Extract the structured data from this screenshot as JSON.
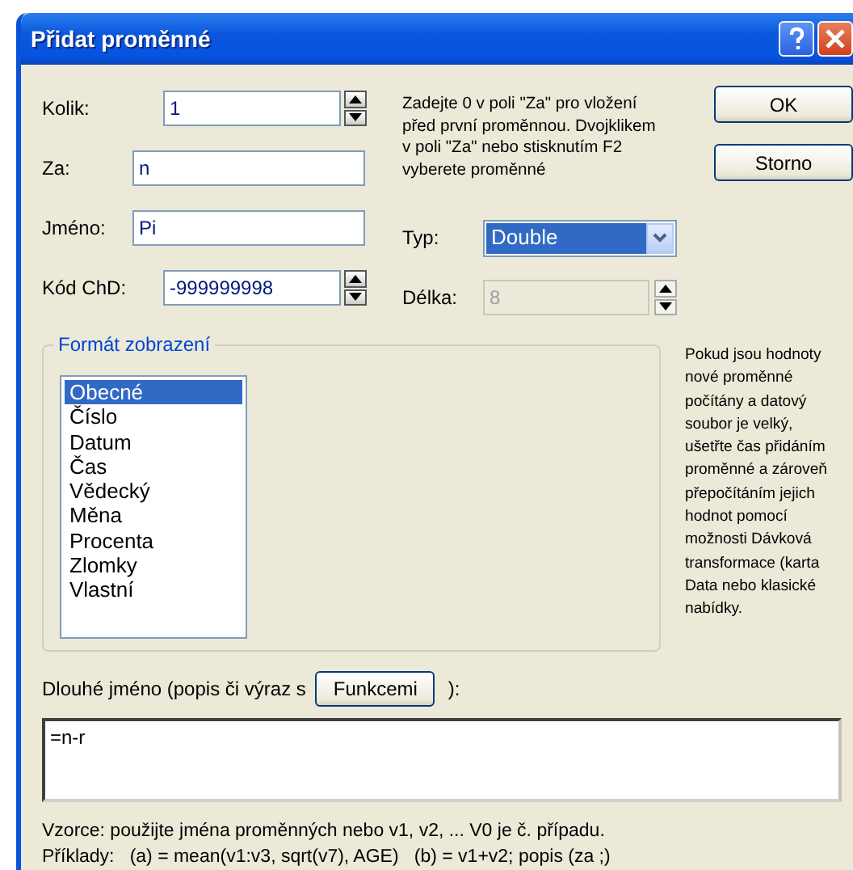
{
  "window": {
    "title": "Přidat proměnné"
  },
  "fields": [
    {
      "kind": "spin",
      "label": "Kolik:",
      "value": "1"
    },
    {
      "kind": "text",
      "label": "Za:",
      "value": "n"
    },
    {
      "kind": "text",
      "label": "Jméno:",
      "value": "Pi"
    },
    {
      "kind": "spin",
      "label": "Kód ChD:",
      "value": "-999999998"
    }
  ],
  "hint": "Zadejte 0 v poli \"Za\" pro vložení před první proměnnou. Dvojklikem v poli \"Za\" nebo stisknutím F2 vyberete proměnné",
  "type_field": {
    "label": "Typ:",
    "value": "Double",
    "focused": true
  },
  "length_field": {
    "label": "Délka:",
    "value": "8",
    "disabled": true
  },
  "buttons": [
    "OK",
    "Storno"
  ],
  "format_group": {
    "title": "Formát zobrazení",
    "items": [
      {
        "label": "Obecné",
        "selected": true
      },
      {
        "label": "Číslo",
        "selected": false
      },
      {
        "label": "Datum",
        "selected": false
      },
      {
        "label": "Čas",
        "selected": false
      },
      {
        "label": "Vědecký",
        "selected": false
      },
      {
        "label": "Měna",
        "selected": false
      },
      {
        "label": "Procenta",
        "selected": false
      },
      {
        "label": "Zlomky",
        "selected": false
      },
      {
        "label": "Vlastní",
        "selected": false
      }
    ]
  },
  "side_note": "Pokud jsou hodnoty nové proměnné počítány a datový soubor je velký, ušetřte čas přidáním proměnné a zároveň přepočítáním jejich hodnot pomocí možnosti Dávková transformace (karta Data nebo klasické nabídky.",
  "long_name": {
    "label": "Dlouhé jméno (popis či výraz s",
    "button": "Funkcemi",
    "suffix": "):",
    "value": "=n-r"
  },
  "footer": [
    "Vzorce: použijte jména proměnných nebo v1, v2, ... V0 je č. případu.",
    "Příklady:   (a) = mean(v1:v3, sqrt(v7), AGE)   (b) = v1+v2; popis (za ;)"
  ]
}
